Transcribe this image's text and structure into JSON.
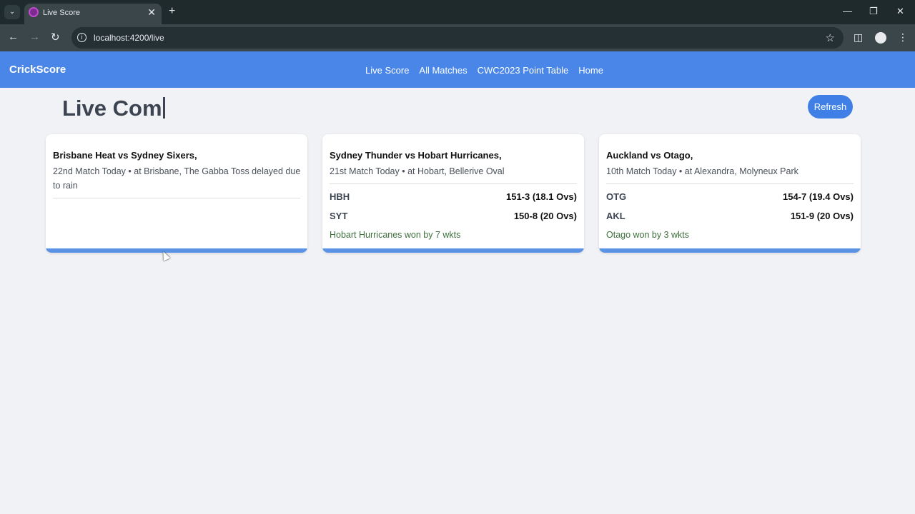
{
  "browser": {
    "tab_title": "Live Score",
    "url": "localhost:4200/live"
  },
  "app": {
    "brand": "CrickScore",
    "nav": [
      "Live Score",
      "All Matches",
      "CWC2023 Point Table",
      "Home"
    ],
    "accent_color": "#4a86e8"
  },
  "page": {
    "title": "Live Com",
    "refresh_label": "Refresh"
  },
  "matches": [
    {
      "title": "Brisbane Heat vs Sydney Sixers,",
      "subtitle": "22nd Match Today • at Brisbane, The Gabba Toss delayed due to rain",
      "scores": [],
      "result": ""
    },
    {
      "title": "Sydney Thunder vs Hobart Hurricanes,",
      "subtitle": "21st Match Today • at Hobart, Bellerive Oval",
      "scores": [
        {
          "team": "HBH",
          "score": "151-3 (18.1 Ovs)"
        },
        {
          "team": "SYT",
          "score": "150-8 (20 Ovs)"
        }
      ],
      "result": "Hobart Hurricanes won by 7 wkts"
    },
    {
      "title": "Auckland vs Otago,",
      "subtitle": "10th Match Today • at Alexandra, Molyneux Park",
      "scores": [
        {
          "team": "OTG",
          "score": "154-7 (19.4 Ovs)"
        },
        {
          "team": "AKL",
          "score": "151-9 (20 Ovs)"
        }
      ],
      "result": "Otago won by 3 wkts"
    }
  ]
}
